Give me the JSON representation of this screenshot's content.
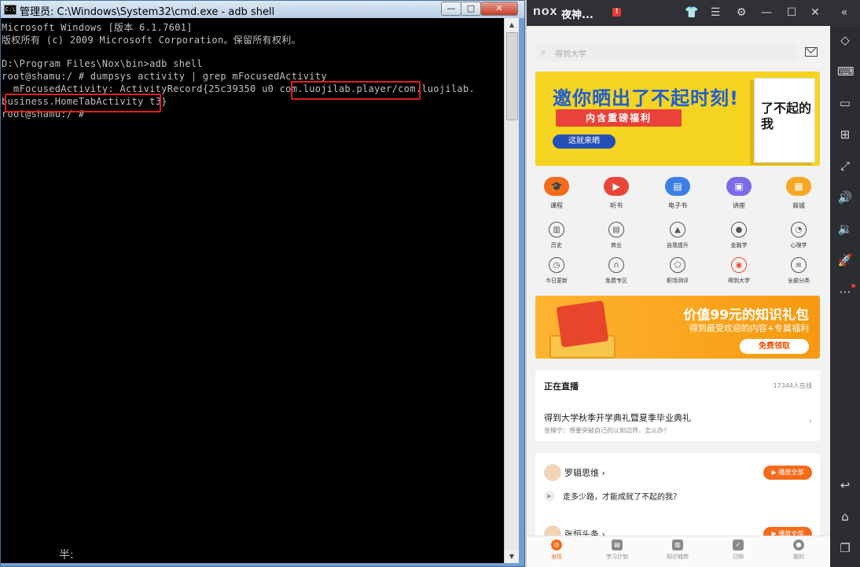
{
  "cmd": {
    "title": "管理员: C:\\Windows\\System32\\cmd.exe - adb  shell",
    "icon_text": "C:\\",
    "lines": [
      "Microsoft Windows [版本 6.1.7601]",
      "版权所有 (c) 2009 Microsoft Corporation。保留所有权利。",
      "",
      "D:\\Program Files\\Nox\\bin>adb shell",
      "root@shamu:/ # dumpsys activity | grep mFocusedActivity",
      "  mFocusedActivity: ActivityRecord{25c39350 u0 com.luojilab.player/com.luojilab.",
      "business.HomeTabActivity t3}",
      "root@shamu:/ #"
    ],
    "ime_text": "半:",
    "controls": {
      "minimize": "—",
      "maximize": "□",
      "close": "✕"
    }
  },
  "nox": {
    "logo": "nox",
    "app_name": "夜神...",
    "alert": "!",
    "toolbar_icons": [
      "shirt-icon",
      "menu-icon",
      "gear-icon",
      "minimize-icon",
      "maximize-icon",
      "close-icon",
      "collapse-icon"
    ],
    "side_icons": [
      "rotate-icon",
      "keyboard-icon",
      "screen-icon",
      "apk-icon",
      "fullscreen-icon",
      "volume-up-icon",
      "volume-down-icon",
      "rocket-icon",
      "more-icon",
      "back-icon",
      "home-icon",
      "recent-icon"
    ]
  },
  "app": {
    "search_placeholder": "得到大学",
    "banner1": {
      "title": "邀你晒出了不起时刻!",
      "subtitle": "内含重磅福利",
      "button": "这就来晒",
      "book_text": "了不起的我"
    },
    "grid_main": [
      "课程",
      "听书",
      "电子书",
      "讲座",
      "商城"
    ],
    "grid_main_colors": [
      "#f46b1b",
      "#e8463a",
      "#3d7fe6",
      "#7a6be8",
      "#f5a623"
    ],
    "grid_row2": [
      "历史",
      "商业",
      "自我提升",
      "金融学",
      "心理学"
    ],
    "grid_row3": [
      "今日更新",
      "免费专区",
      "职场测评",
      "得到大学",
      "全部分类"
    ],
    "banner2": {
      "title": "价值99元的知识礼包",
      "subtitle": "得到最受欢迎的内容+专属福利",
      "button": "免费领取"
    },
    "live": {
      "title": "正在直播",
      "count": "17344人在线",
      "headline": "得到大学秋季开学典礼暨夏季毕业典礼",
      "speaker": "张楠宁：想要突破自己的认知边界，怎么办？",
      "arrow": "›"
    },
    "feed": [
      {
        "name": "罗辑思维 ›",
        "play": "▶ 播放全部",
        "episode": "走多少路，才能成就了不起的我？"
      },
      {
        "name": "张恒头条 ›",
        "play": "▶ 播放全部"
      }
    ],
    "tabs": [
      "发现",
      "学习计划",
      "知识城邦",
      "已购",
      "我的"
    ]
  }
}
